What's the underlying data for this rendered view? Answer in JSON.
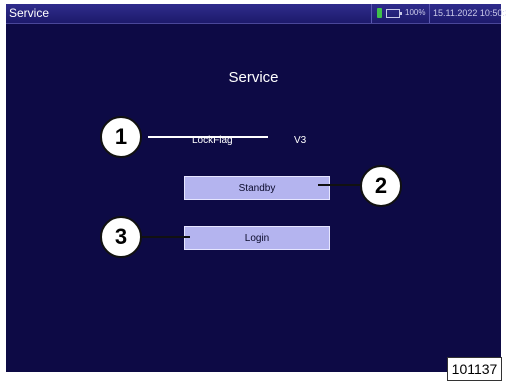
{
  "titlebar": {
    "app_title": "Service",
    "status": {
      "power_icon": "plug-icon",
      "battery_icon": "battery-icon",
      "battery_percent": "100%",
      "datetime": "15.11.2022 10:50:34"
    }
  },
  "main": {
    "page_title": "Service",
    "lock_label": "LockFlag",
    "lock_value": "V3",
    "buttons": {
      "standby": "Standby",
      "login": "Login"
    }
  },
  "callouts": [
    "1",
    "2",
    "3"
  ],
  "figure_id": "101137",
  "colors": {
    "screen_background": "#0d0a45",
    "titlebar": "#2f2c8c",
    "button": "#b4b4ef"
  }
}
